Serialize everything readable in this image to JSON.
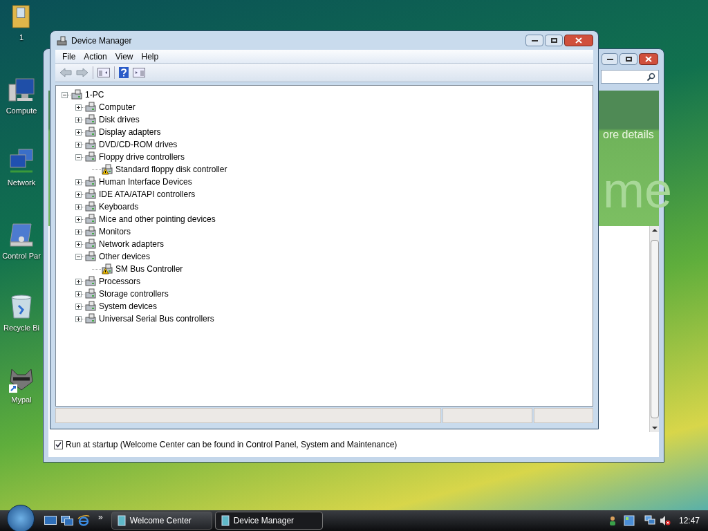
{
  "desktop_icons": [
    {
      "label": "1"
    },
    {
      "label": "Compute"
    },
    {
      "label": "Network"
    },
    {
      "label": "Control Par"
    },
    {
      "label": "Recycle Bi"
    },
    {
      "label": "Mypal"
    }
  ],
  "welcome_window": {
    "banner_text": "ore details",
    "banner_big_text": "me",
    "startup_checkbox": {
      "label": "Run at startup (Welcome Center can be found in Control Panel, System and Maintenance)",
      "checked": true
    }
  },
  "device_manager": {
    "title": "Device Manager",
    "menu": [
      "File",
      "Action",
      "View",
      "Help"
    ],
    "tree": {
      "label": "1-PC",
      "expanded": true,
      "children": [
        {
          "label": "Computer",
          "expanded": false
        },
        {
          "label": "Disk drives",
          "expanded": false
        },
        {
          "label": "Display adapters",
          "expanded": false
        },
        {
          "label": "DVD/CD-ROM drives",
          "expanded": false
        },
        {
          "label": "Floppy drive controllers",
          "expanded": true,
          "children": [
            {
              "label": "Standard floppy disk controller",
              "warning": true
            }
          ]
        },
        {
          "label": "Human Interface Devices",
          "expanded": false
        },
        {
          "label": "IDE ATA/ATAPI controllers",
          "expanded": false
        },
        {
          "label": "Keyboards",
          "expanded": false
        },
        {
          "label": "Mice and other pointing devices",
          "expanded": false
        },
        {
          "label": "Monitors",
          "expanded": false
        },
        {
          "label": "Network adapters",
          "expanded": false
        },
        {
          "label": "Other devices",
          "expanded": true,
          "children": [
            {
              "label": "SM Bus Controller",
              "warning": true
            }
          ]
        },
        {
          "label": "Processors",
          "expanded": false
        },
        {
          "label": "Storage controllers",
          "expanded": false
        },
        {
          "label": "System devices",
          "expanded": false
        },
        {
          "label": "Universal Serial Bus controllers",
          "expanded": false
        }
      ]
    }
  },
  "taskbar": {
    "overflow": "»",
    "tasks": [
      {
        "label": "Welcome Center",
        "selected": false
      },
      {
        "label": "Device Manager",
        "selected": true
      }
    ],
    "clock": "12:47"
  }
}
